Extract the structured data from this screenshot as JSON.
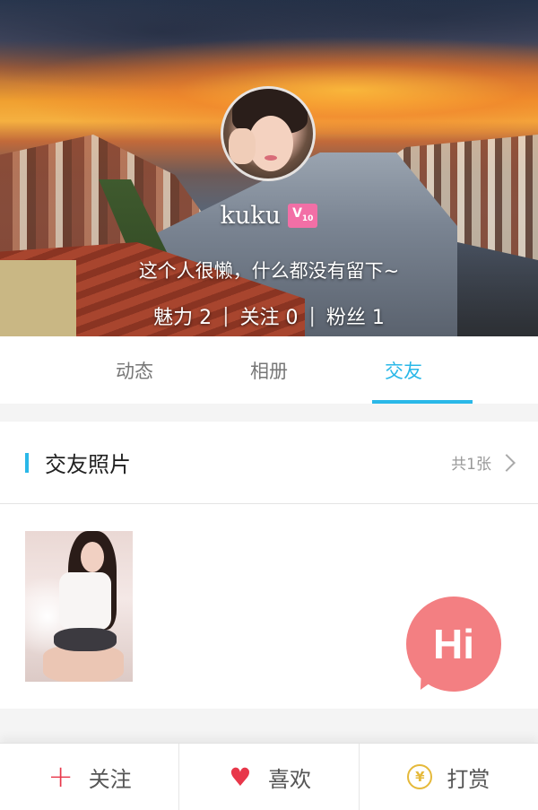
{
  "profile": {
    "name": "kuku",
    "vip_badge": "V",
    "vip_level": "10",
    "bio": "这个人很懒，什么都没有留下~",
    "stats": {
      "charm": "魅力 2",
      "following": "关注 0",
      "fans": "粉丝 1"
    }
  },
  "tabs": [
    {
      "label": "动态",
      "active": false
    },
    {
      "label": "相册",
      "active": false
    },
    {
      "label": "交友",
      "active": true
    }
  ],
  "friend_photos": {
    "title": "交友照片",
    "count": "共1张",
    "hi_label": "Hi"
  },
  "bottom_bar": {
    "follow": "关注",
    "like": "喜欢",
    "reward": "打赏",
    "reward_icon_glyph": "¥"
  },
  "colors": {
    "accent": "#2ab8e8",
    "action_red": "#e8374a",
    "hi_bubble": "#f37f82",
    "coin": "#e5b93a"
  }
}
